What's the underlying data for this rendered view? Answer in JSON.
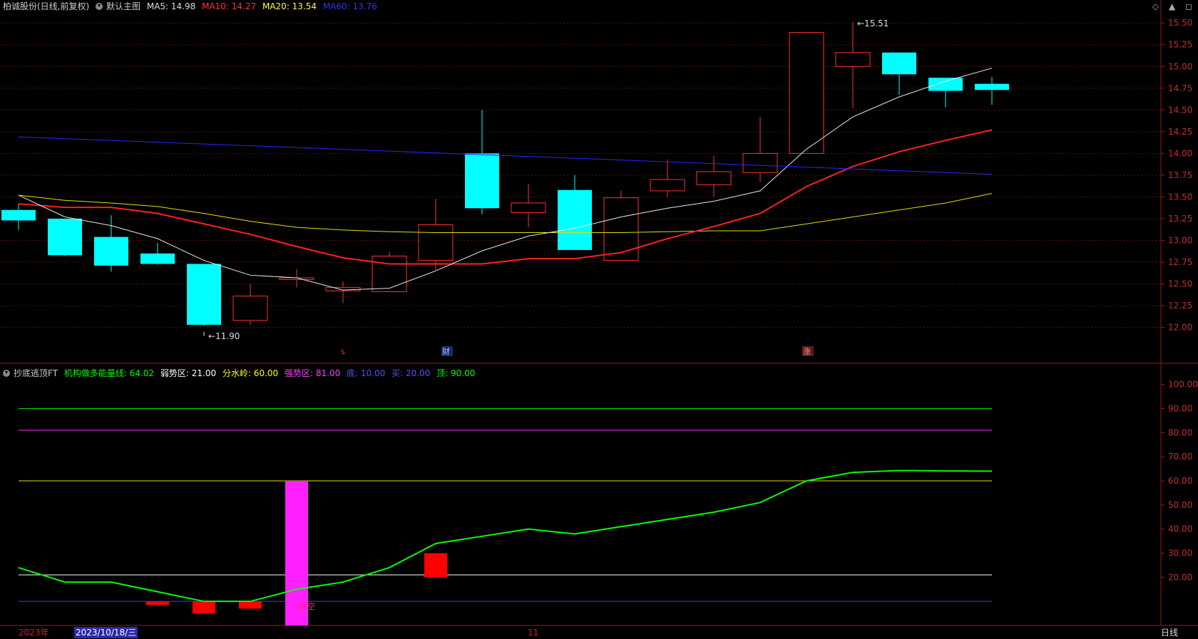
{
  "header": {
    "stock_name": "柏诚股份(日线,前复权)",
    "template": "默认主图",
    "ma5": "MA5: 14.98",
    "ma10": "MA10: 14.27",
    "ma20": "MA20: 13.54",
    "ma60": "MA60: 13.76",
    "colors": {
      "ma5": "#ffffff",
      "ma10": "#ff2020",
      "ma20": "#ffff00",
      "ma60": "#2020ff"
    }
  },
  "indicator_header": {
    "name": "抄底逃顶FT",
    "energy": "机构做多能量线: 64.02",
    "weak": "弱势区: 21.00",
    "watershed": "分水岭: 60.00",
    "strong": "强势区: 81.00",
    "bottom": "底: 10.00",
    "buy": "买: 20.00",
    "top": "顶: 90.00",
    "colors": {
      "energy": "#00ff00",
      "weak": "#ffffff",
      "watershed": "#ffff00",
      "strong": "#ff00ff",
      "bottom": "#4040ff",
      "buy": "#4040ff",
      "top": "#00ff00"
    }
  },
  "top_icons": [
    "◇",
    "▲",
    "◻"
  ],
  "markers": {
    "low": "11.90",
    "high": "15.51",
    "m1": "s",
    "m2": "财",
    "m3": "涨",
    "jump": "跳空"
  },
  "bottom_bar": {
    "year": "2023年",
    "date": "2023/10/18/三",
    "month": "11",
    "period": "日线"
  },
  "chart_data": [
    {
      "type": "candlestick",
      "ylim": [
        11.8,
        15.6
      ],
      "yticks": [
        "15.50",
        "15.25",
        "15.00",
        "14.75",
        "14.50",
        "14.25",
        "14.00",
        "13.75",
        "13.50",
        "13.25",
        "13.00",
        "12.75",
        "12.50",
        "12.25",
        "12.00"
      ],
      "candles": [
        {
          "o": 13.35,
          "h": 13.42,
          "l": 13.12,
          "c": 13.23
        },
        {
          "o": 13.25,
          "h": 13.25,
          "l": 12.82,
          "c": 12.83
        },
        {
          "o": 13.04,
          "h": 13.29,
          "l": 12.64,
          "c": 12.71
        },
        {
          "o": 12.85,
          "h": 12.97,
          "l": 12.72,
          "c": 12.73
        },
        {
          "o": 12.73,
          "h": 12.73,
          "l": 12.02,
          "c": 12.03
        },
        {
          "o": 12.08,
          "h": 12.5,
          "l": 12.03,
          "c": 12.36
        },
        {
          "o": 12.55,
          "h": 12.67,
          "l": 12.46,
          "c": 12.57
        },
        {
          "o": 12.42,
          "h": 12.53,
          "l": 12.28,
          "c": 12.46
        },
        {
          "o": 12.41,
          "h": 12.87,
          "l": 12.41,
          "c": 12.82
        },
        {
          "o": 12.77,
          "h": 13.48,
          "l": 12.66,
          "c": 13.18
        },
        {
          "o": 14.0,
          "h": 14.5,
          "l": 13.3,
          "c": 13.37
        },
        {
          "o": 13.32,
          "h": 13.65,
          "l": 13.15,
          "c": 13.43
        },
        {
          "o": 13.58,
          "h": 13.75,
          "l": 12.89,
          "c": 12.89
        },
        {
          "o": 12.77,
          "h": 13.57,
          "l": 12.77,
          "c": 13.49
        },
        {
          "o": 13.57,
          "h": 13.93,
          "l": 13.5,
          "c": 13.7
        },
        {
          "o": 13.64,
          "h": 13.97,
          "l": 13.5,
          "c": 13.79
        },
        {
          "o": 13.78,
          "h": 14.42,
          "l": 13.67,
          "c": 14.0
        },
        {
          "o": 14.0,
          "h": 15.39,
          "l": 14.0,
          "c": 15.39
        },
        {
          "o": 15.0,
          "h": 15.51,
          "l": 14.52,
          "c": 15.16
        },
        {
          "o": 15.16,
          "h": 15.16,
          "l": 14.67,
          "c": 14.91
        },
        {
          "o": 14.87,
          "h": 14.87,
          "l": 14.53,
          "c": 14.72
        },
        {
          "o": 14.8,
          "h": 14.88,
          "l": 14.56,
          "c": 14.73
        }
      ],
      "ma5": [
        13.52,
        13.27,
        13.17,
        13.02,
        12.77,
        12.6,
        12.57,
        12.43,
        12.45,
        12.65,
        12.88,
        13.05,
        13.14,
        13.27,
        13.37,
        13.45,
        13.57,
        14.05,
        14.42,
        14.65,
        14.83,
        14.98
      ],
      "ma10": [
        13.42,
        13.38,
        13.38,
        13.31,
        13.19,
        13.07,
        12.93,
        12.8,
        12.73,
        12.73,
        12.73,
        12.79,
        12.79,
        12.86,
        13.02,
        13.16,
        13.31,
        13.62,
        13.85,
        14.02,
        14.15,
        14.27
      ],
      "ma20": [
        13.52,
        13.46,
        13.43,
        13.39,
        13.31,
        13.22,
        13.15,
        13.12,
        13.1,
        13.09,
        13.09,
        13.09,
        13.09,
        13.09,
        13.1,
        13.11,
        13.11,
        13.19,
        13.27,
        13.35,
        13.43,
        13.54
      ],
      "ma60_start": 14.19,
      "ma60_end": 13.76
    },
    {
      "type": "line",
      "ylim": [
        0,
        107
      ],
      "yticks": [
        "100.00",
        "90.00",
        "80.00",
        "70.00",
        "60.00",
        "50.00",
        "40.00",
        "30.00",
        "20.00"
      ],
      "series": [
        {
          "name": "机构做多能量线",
          "values": [
            24,
            18,
            18,
            14,
            10,
            10,
            15,
            18,
            24,
            34,
            37,
            40,
            38,
            41,
            44,
            47,
            51,
            60,
            63.5,
            64.3,
            64.1,
            64.02
          ]
        }
      ],
      "levels": {
        "top": 90,
        "strong": 81,
        "watershed": 60,
        "weak": 21,
        "bottom": 10
      },
      "bars": [
        {
          "index": 3,
          "from": 10,
          "to": 8.5,
          "color": "#ff0000"
        },
        {
          "index": 4,
          "from": 10,
          "to": 5,
          "color": "#ff0000"
        },
        {
          "index": 5,
          "from": 10,
          "to": 7,
          "color": "#ff0000"
        },
        {
          "index": 6,
          "from": 60,
          "to": 0,
          "color": "#ff20ff"
        },
        {
          "index": 9,
          "from": 30,
          "to": 20,
          "color": "#ff0000"
        }
      ]
    }
  ]
}
